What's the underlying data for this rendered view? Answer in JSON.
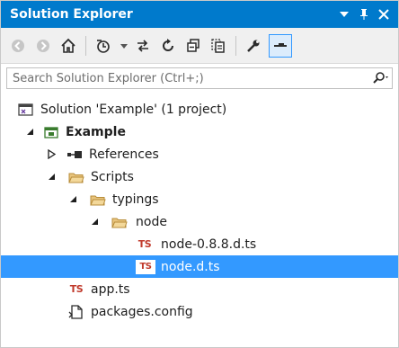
{
  "window": {
    "title": "Solution Explorer"
  },
  "search": {
    "placeholder": "Search Solution Explorer (Ctrl+;)"
  },
  "tree": {
    "solution": "Solution 'Example' (1 project)",
    "project": "Example",
    "references": "References",
    "scripts": "Scripts",
    "typings": "typings",
    "node_folder": "node",
    "file1": "node-0.8.8.d.ts",
    "file2": "node.d.ts",
    "app": "app.ts",
    "packages": "packages.config",
    "ts_badge": "TS"
  },
  "colors": {
    "accent": "#007acc",
    "selection": "#3399ff",
    "ts_red": "#c0392b",
    "folder": "#d9b26b"
  }
}
